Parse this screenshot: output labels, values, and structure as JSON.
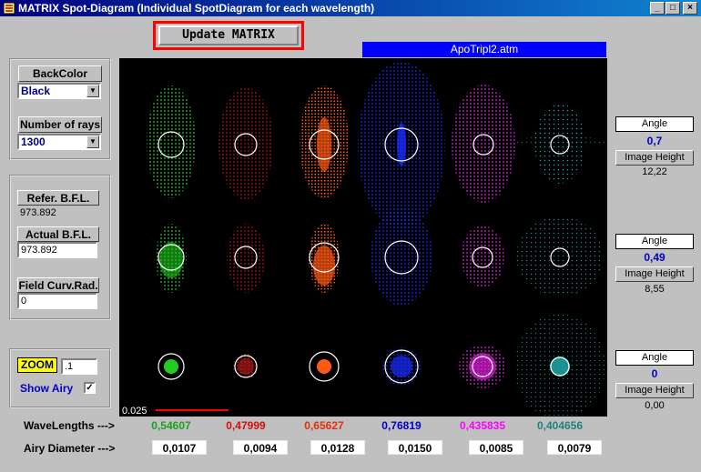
{
  "window": {
    "title": "MATRIX  Spot-Diagram (Individual SpotDiagram for each  wavelength)",
    "minimize": "_",
    "maximize": "□",
    "close": "×"
  },
  "toolbar": {
    "update_label": "Update  MATRIX"
  },
  "file_banner": "ApoTripl2.atm",
  "backcolor": {
    "label": "BackColor",
    "value": "Black"
  },
  "rays": {
    "label": "Number of rays",
    "value": "1300"
  },
  "refer_bfl": {
    "label": "Refer. B.F.L.",
    "value": "973.892"
  },
  "actual_bfl": {
    "label": "Actual  B.F.L.",
    "value": "973.892"
  },
  "field_curv": {
    "label": "Field Curv.Rad.",
    "value": "0"
  },
  "zoom": {
    "label": "ZOOM",
    "value": ".1"
  },
  "show_airy": {
    "label": "Show Airy",
    "checked": true
  },
  "scale_label": "0.025",
  "fields": [
    {
      "angle_label": "Angle",
      "angle": "0,7",
      "height_label": "Image Height",
      "height": "12,22"
    },
    {
      "angle_label": "Angle",
      "angle": "0,49",
      "height_label": "Image Height",
      "height": "8,55"
    },
    {
      "angle_label": "Angle",
      "angle": "0",
      "height_label": "Image Height",
      "height": "0,00"
    }
  ],
  "wavelengths_label": "WaveLengths --->",
  "airy_label": "Airy Diameter --->",
  "wavelengths": [
    {
      "value": "0,54607",
      "airy": "0,0107",
      "color": "#1e9e1e"
    },
    {
      "value": "0,47999",
      "airy": "0,0094",
      "color": "#d01010"
    },
    {
      "value": "0,65627",
      "airy": "0,0128",
      "color": "#e03010"
    },
    {
      "value": "0,76819",
      "airy": "0,0150",
      "color": "#0000c8"
    },
    {
      "value": "0,435835",
      "airy": "0,0085",
      "color": "#ff00ff"
    },
    {
      "value": "0,404656",
      "airy": "0,0079",
      "color": "#208080"
    }
  ],
  "spot_colors": [
    "#22cc22",
    "#b01818",
    "#ff5a14",
    "#1a2cff",
    "#e020e0",
    "#20a0a0"
  ]
}
